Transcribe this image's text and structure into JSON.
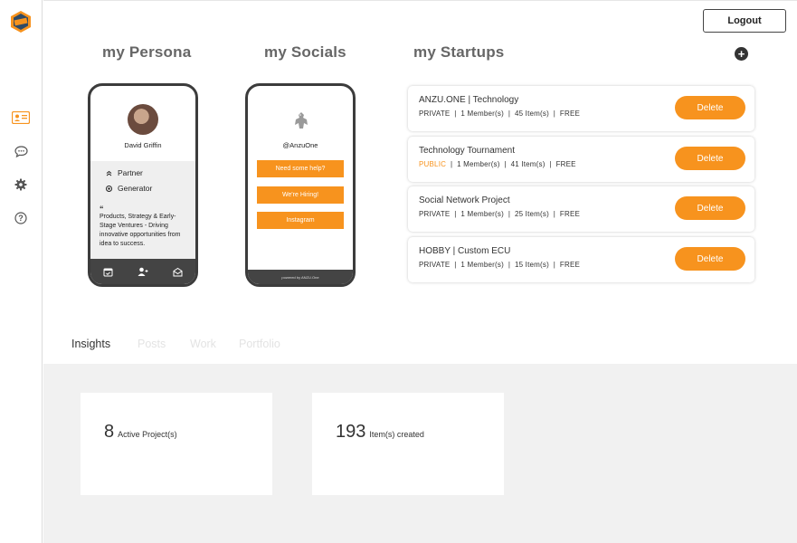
{
  "sidebar": {
    "logo_icon": "anzu-hexagon-logo",
    "items": [
      {
        "icon": "id-card-icon",
        "active": true
      },
      {
        "icon": "chat-bubble-icon",
        "active": false
      },
      {
        "icon": "gear-icon",
        "active": false
      },
      {
        "icon": "help-circle-icon",
        "active": false
      }
    ]
  },
  "header": {
    "logout_label": "Logout"
  },
  "sections": {
    "persona_title": "my Persona",
    "socials_title": "my Socials",
    "startups_title": "my Startups",
    "add_icon": "plus-circle-icon"
  },
  "persona": {
    "name": "David Griffin",
    "roles": [
      "Partner",
      "Generator"
    ],
    "quote_mark": "“",
    "bio": "Products, Strategy & Early-Stage Ventures - Driving innovative opportunities from idea to success.",
    "footer_icons": [
      "calendar-check-icon",
      "add-user-icon",
      "mail-open-icon"
    ]
  },
  "socials": {
    "handle": "@AnzuOne",
    "buttons": [
      "Need some help?",
      "We're Hiring!",
      "Instagram"
    ],
    "powered_by": "powered by ANZU.One"
  },
  "startups": [
    {
      "title": "ANZU.ONE | Technology",
      "visibility": "PRIVATE",
      "members": "1 Member(s)",
      "items": "45 Item(s)",
      "plan": "FREE",
      "delete_label": "Delete"
    },
    {
      "title": "Technology Tournament",
      "visibility": "PUBLIC",
      "members": "1 Member(s)",
      "items": "41  Item(s)",
      "plan": "FREE",
      "delete_label": "Delete"
    },
    {
      "title": "Social Network Project",
      "visibility": "PRIVATE",
      "members": "1 Member(s)",
      "items": "25 Item(s)",
      "plan": "FREE",
      "delete_label": "Delete"
    },
    {
      "title": "HOBBY | Custom ECU",
      "visibility": "PRIVATE",
      "members": "1 Member(s)",
      "items": "15 Item(s)",
      "plan": "FREE",
      "delete_label": "Delete"
    }
  ],
  "tabs": [
    {
      "label": "Insights",
      "active": true
    },
    {
      "label": "Posts",
      "active": false
    },
    {
      "label": "Work",
      "active": false
    },
    {
      "label": "Portfolio",
      "active": false
    }
  ],
  "insights": [
    {
      "value": "8",
      "label": "Active Project(s)"
    },
    {
      "value": "193",
      "label": "Item(s) created"
    }
  ],
  "colors": {
    "accent": "#f7931e",
    "dark": "#3c3c3c",
    "panel": "#f1f1f1"
  }
}
